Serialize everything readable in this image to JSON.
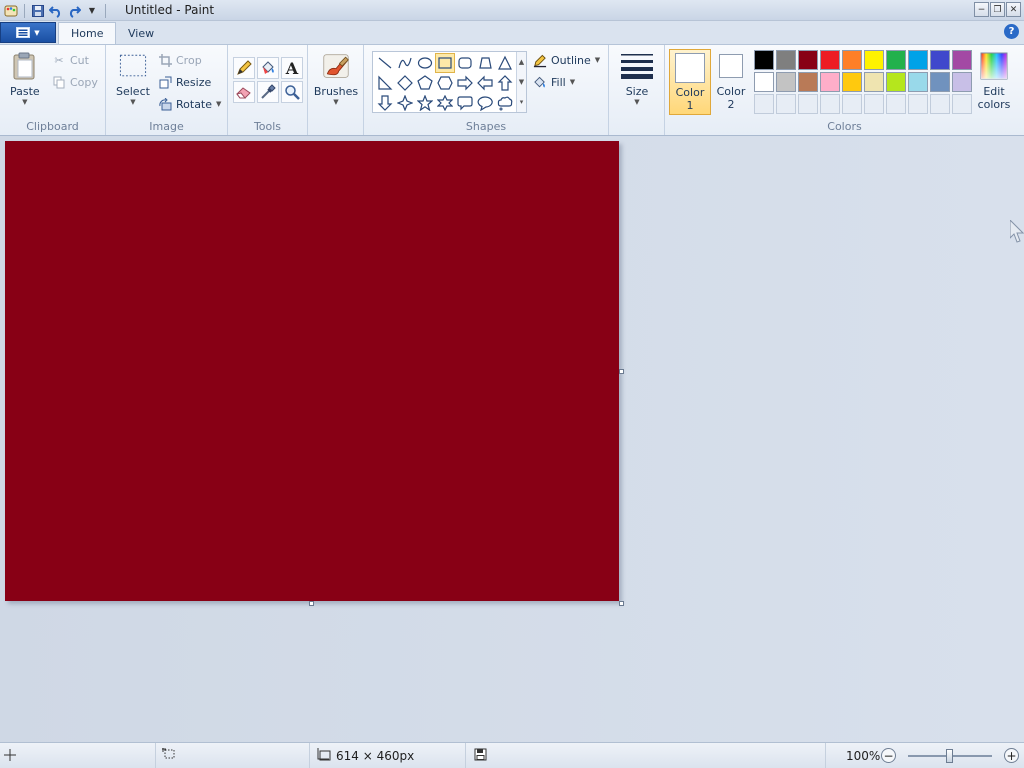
{
  "window": {
    "title": "Untitled - Paint",
    "controls": {
      "minimize": "−",
      "restore": "❐",
      "close": "✕"
    }
  },
  "tabs": [
    {
      "label": "Home",
      "active": true
    },
    {
      "label": "View",
      "active": false
    }
  ],
  "help": "?",
  "ribbon": {
    "clipboard": {
      "label": "Clipboard",
      "paste": "Paste",
      "cut": "Cut",
      "copy": "Copy"
    },
    "image": {
      "label": "Image",
      "select": "Select",
      "crop": "Crop",
      "resize": "Resize",
      "rotate": "Rotate"
    },
    "tools": {
      "label": "Tools",
      "text_glyph": "A"
    },
    "brushes": {
      "label": "Brushes"
    },
    "shapes": {
      "label": "Shapes",
      "outline": "Outline",
      "fill": "Fill"
    },
    "size": {
      "label": "Size"
    },
    "colors": {
      "label": "Colors",
      "color1": {
        "line1": "Color",
        "line2": "1",
        "value": "#ffffff"
      },
      "color2": {
        "line1": "Color",
        "line2": "2",
        "value": "#ffffff"
      },
      "edit_line1": "Edit",
      "edit_line2": "colors",
      "palette_row1": [
        "#000000",
        "#7f7f7f",
        "#880015",
        "#ed1c24",
        "#ff7f27",
        "#fff200",
        "#22b14c",
        "#00a2e8",
        "#3f48cc",
        "#a349a4"
      ],
      "palette_row2": [
        "#ffffff",
        "#c3c3c3",
        "#b97a57",
        "#ffaec9",
        "#ffc90e",
        "#efe4b0",
        "#b5e61d",
        "#99d9ea",
        "#7092be",
        "#c8bfe7"
      ]
    }
  },
  "canvas": {
    "fill_color": "#880015"
  },
  "status": {
    "dimensions": "614 × 460px",
    "zoom": "100%",
    "zoom_out": "−",
    "zoom_in": "+"
  }
}
